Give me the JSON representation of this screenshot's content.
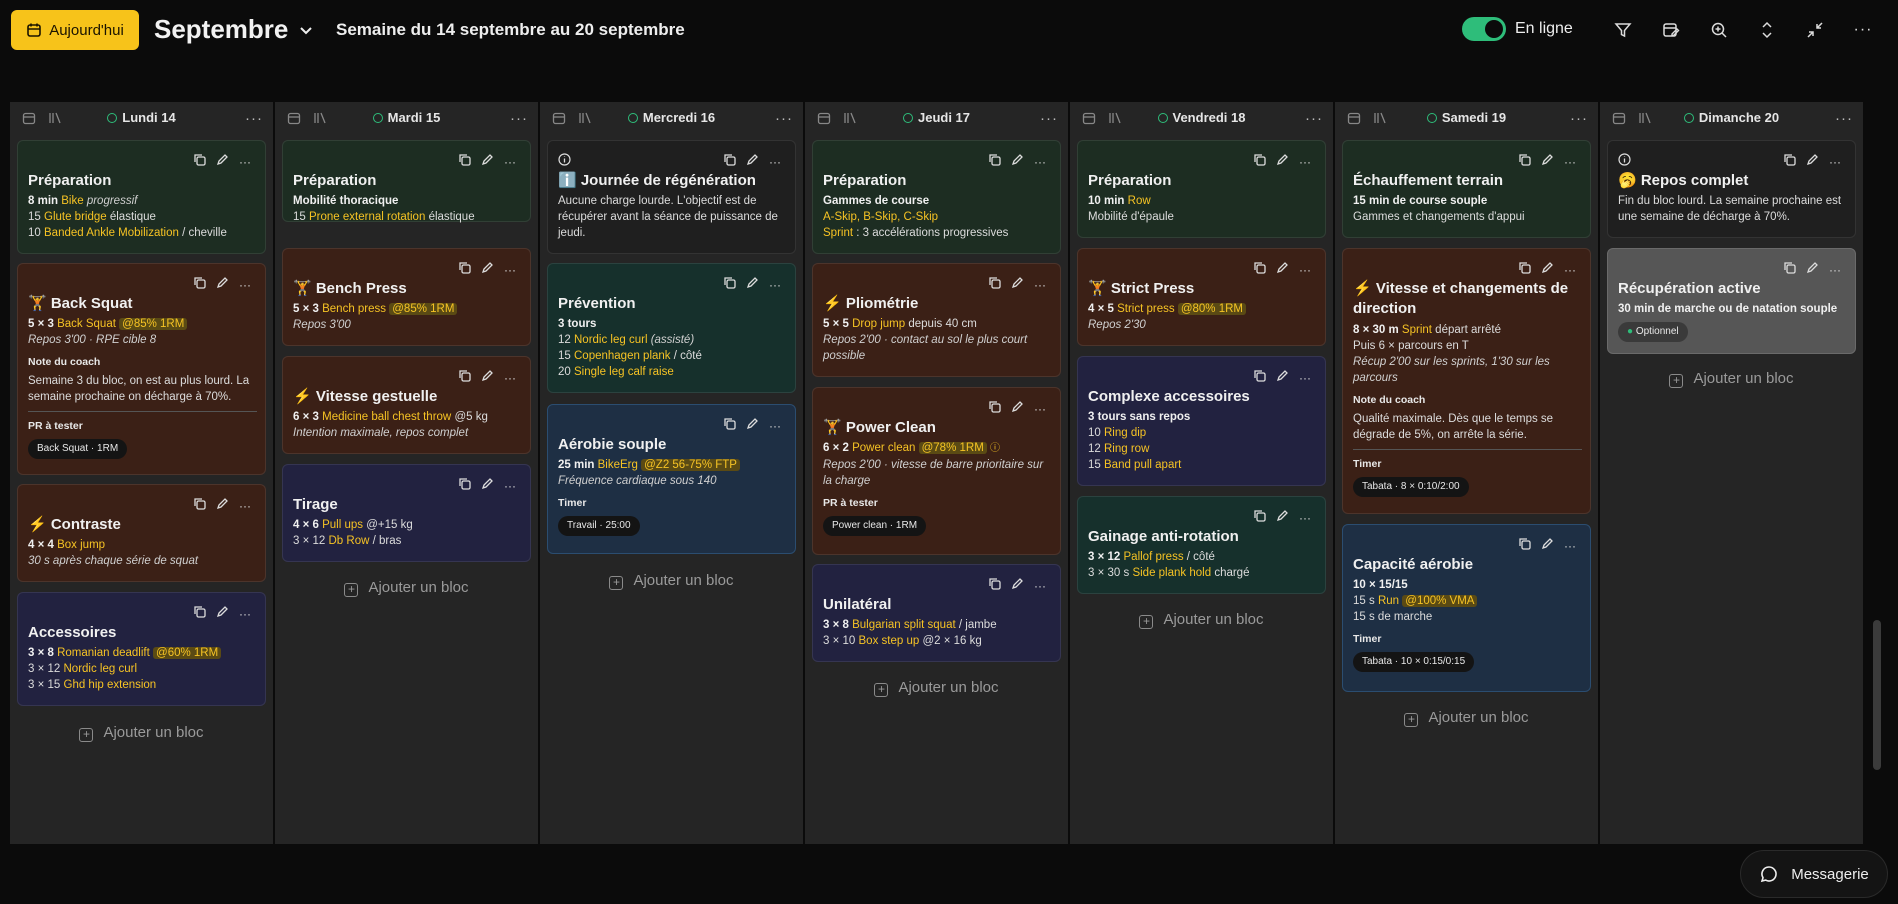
{
  "header": {
    "today_label": "Aujourd'hui",
    "month": "Septembre",
    "week_label": "Semaine du 14 septembre au 20 septembre",
    "online_label": "En ligne"
  },
  "colors": {
    "accent": "#f7c31a",
    "online": "#2ebd7a",
    "highlight": "#f6c324"
  },
  "add_label": "Ajouter un bloc",
  "days": [
    {
      "name": "Lundi 14"
    },
    {
      "name": "Mardi 15"
    },
    {
      "name": "Mercredi 16"
    },
    {
      "name": "Jeudi 17"
    },
    {
      "name": "Vendredi 18"
    },
    {
      "name": "Samedi 19"
    },
    {
      "name": "Dimanche 20"
    }
  ],
  "c1": {
    "b1": {
      "title": "Préparation",
      "l1a": "8 min",
      "l1b": "Bike",
      "l1c": "progressif",
      "l2a": "15",
      "l2b": "Glute bridge",
      "l2c": "élastique",
      "l3a": "10",
      "l3b": "Banded Ankle Mobilization",
      "l3c": "/ cheville"
    },
    "b2": {
      "title": "🏋 Back Squat",
      "l1a": "5 × 3",
      "l1b": "Back Squat",
      "l1c": "@85% 1RM",
      "l2": "Repos 3'00 · RPE cible 8",
      "note_label": "Note du coach",
      "note": "Semaine 3 du bloc, on est au plus lourd. La semaine prochaine on décharge à 70%.",
      "pr_label": "PR à tester",
      "pr": "Back Squat · 1RM"
    },
    "b3": {
      "title": "⚡ Contraste",
      "l1a": "4 × 4",
      "l1b": "Box jump",
      "l2": "30 s après chaque série de squat"
    },
    "b4": {
      "title": "Accessoires",
      "l1a": "3 × 8",
      "l1b": "Romanian deadlift",
      "l1c": "@60% 1RM",
      "l2a": "3 × 12",
      "l2b": "Nordic leg curl",
      "l3a": "3 × 15",
      "l3b": "Ghd hip extension"
    }
  },
  "c2": {
    "b1": {
      "title": "Préparation",
      "l1": "Mobilité thoracique",
      "l2a": "15",
      "l2b": "Prone external rotation",
      "l2c": "élastique"
    },
    "b2": {
      "title": "🏋 Bench Press",
      "l1a": "5 × 3",
      "l1b": "Bench press",
      "l1c": "@85% 1RM",
      "l2": "Repos 3'00"
    },
    "b3": {
      "title": "⚡ Vitesse gestuelle",
      "l1a": "6 × 3",
      "l1b": "Medicine ball chest throw",
      "l1c": "@5 kg",
      "l2": "Intention maximale, repos complet"
    },
    "b4": {
      "title": "Tirage",
      "l1a": "4 × 6",
      "l1b": "Pull ups",
      "l1c": "@+15 kg",
      "l2a": "3 × 12",
      "l2b": "Db Row",
      "l2c": "/ bras"
    }
  },
  "c3": {
    "b1": {
      "title": "ℹ️ Journée de régénération",
      "text": "Aucune charge lourde. L'objectif est de récupérer avant la séance de puissance de jeudi."
    },
    "b2": {
      "title": "Prévention",
      "l1": "3 tours",
      "l2a": "12",
      "l2b": "Nordic leg curl",
      "l2c": "(assisté)",
      "l3a": "15",
      "l3b": "Copenhagen plank",
      "l3c": "/ côté",
      "l4a": "20",
      "l4b": "Single leg calf raise"
    },
    "b3": {
      "title": "Aérobie souple",
      "l1a": "25 min",
      "l1b": "BikeErg",
      "l1c": "@Z2 56-75% FTP",
      "l2": "Fréquence cardiaque sous 140",
      "timer_label": "Timer",
      "timer": "Travail · 25:00"
    }
  },
  "c4": {
    "b1": {
      "title": "Préparation",
      "l1": "Gammes de course",
      "l2": "A-Skip, B-Skip, C-Skip",
      "l3a": "Sprint",
      "l3b": ": 3 accélérations progressives"
    },
    "b2": {
      "title": "⚡ Pliométrie",
      "l1a": "5 × 5",
      "l1b": "Drop jump",
      "l1c": "depuis 40 cm",
      "l2": "Repos 2'00 · contact au sol le plus court possible"
    },
    "b3": {
      "title": "🏋 Power Clean",
      "l1a": "6 × 2",
      "l1b": "Power clean",
      "l1c": "@78% 1RM",
      "l2": "Repos 2'00 · vitesse de barre prioritaire sur la charge",
      "pr_label": "PR à tester",
      "pr": "Power clean · 1RM"
    },
    "b4": {
      "title": "Unilatéral",
      "l1a": "3 × 8",
      "l1b": "Bulgarian split squat",
      "l1c": "/ jambe",
      "l2a": "3 × 10",
      "l2b": "Box step up",
      "l2c": "@2 × 16 kg"
    }
  },
  "c5": {
    "b1": {
      "title": "Préparation",
      "l1a": "10 min",
      "l1b": "Row",
      "l2": "Mobilité d'épaule"
    },
    "b2": {
      "title": "🏋 Strict Press",
      "l1a": "4 × 5",
      "l1b": "Strict press",
      "l1c": "@80% 1RM",
      "l2": "Repos 2'30"
    },
    "b3": {
      "title": "Complexe accessoires",
      "l1": "3 tours sans repos",
      "l2a": "10",
      "l2b": "Ring dip",
      "l3a": "12",
      "l3b": "Ring row",
      "l4a": "15",
      "l4b": "Band pull apart"
    },
    "b4": {
      "title": "Gainage anti-rotation",
      "l1a": "3 × 12",
      "l1b": "Pallof press",
      "l1c": "/ côté",
      "l2a": "3 × 30 s",
      "l2b": "Side plank hold",
      "l2c": "chargé"
    }
  },
  "c6": {
    "b1": {
      "title": "Échauffement terrain",
      "l1": "15 min de course souple",
      "l2": "Gammes et changements d'appui"
    },
    "b2": {
      "title": "⚡ Vitesse et changements de direction",
      "l1a": "8 × 30 m",
      "l1b": "Sprint",
      "l1c": "départ arrêté",
      "l2": "Puis 6 × parcours en T",
      "l3": "Récup 2'00 sur les sprints, 1'30 sur les parcours",
      "note_label": "Note du coach",
      "note": "Qualité maximale. Dès que le temps se dégrade de 5%, on arrête la série.",
      "timer_label": "Timer",
      "timer": "Tabata · 8 × 0:10/2:00"
    },
    "b3": {
      "title": "Capacité aérobie",
      "l1": "10 × 15/15",
      "l2a": "15 s",
      "l2b": "Run",
      "l2c": "@100% VMA",
      "l3": "15 s de marche",
      "timer_label": "Timer",
      "timer": "Tabata · 10 × 0:15/0:15"
    }
  },
  "c7": {
    "b1": {
      "title": "🥱 Repos complet",
      "text": "Fin du bloc lourd. La semaine prochaine est une semaine de décharge à 70%."
    },
    "b2": {
      "title": "Récupération active",
      "l1": "30 min de marche ou de natation souple",
      "tag": "Optionnel"
    }
  },
  "messaging_label": "Messagerie"
}
